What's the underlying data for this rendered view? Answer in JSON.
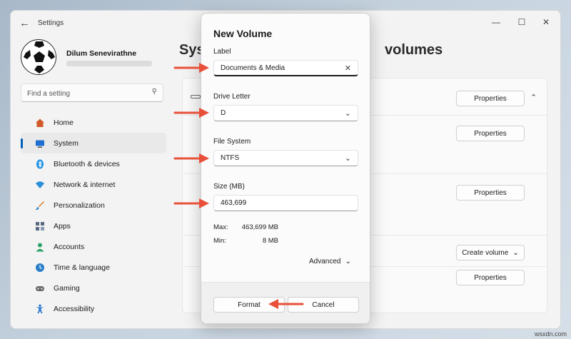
{
  "window": {
    "title": "Settings"
  },
  "profile": {
    "name": "Dilum Senevirathne"
  },
  "search": {
    "placeholder": "Find a setting"
  },
  "nav": {
    "items": [
      {
        "label": "Home",
        "icon": "home-icon",
        "color": "#d05a2a"
      },
      {
        "label": "System",
        "icon": "monitor-icon",
        "color": "#1f6fd0"
      },
      {
        "label": "Bluetooth & devices",
        "icon": "bluetooth-icon",
        "color": "#1a8fe3"
      },
      {
        "label": "Network & internet",
        "icon": "wifi-icon",
        "color": "#2a8fd8"
      },
      {
        "label": "Personalization",
        "icon": "brush-icon",
        "color": "#d47a2a"
      },
      {
        "label": "Apps",
        "icon": "apps-icon",
        "color": "#5a6a82"
      },
      {
        "label": "Accounts",
        "icon": "person-icon",
        "color": "#2fa36b"
      },
      {
        "label": "Time & language",
        "icon": "globe-clock-icon",
        "color": "#2a7fc8"
      },
      {
        "label": "Gaming",
        "icon": "gamepad-icon",
        "color": "#6a6a6a"
      },
      {
        "label": "Accessibility",
        "icon": "accessibility-icon",
        "color": "#1a6fd0"
      }
    ]
  },
  "page": {
    "title_left": "Sys",
    "title_right": "volumes"
  },
  "content": {
    "properties_label": "Properties",
    "create_volume_label": "Create volume"
  },
  "dialog": {
    "title": "New Volume",
    "label_field": {
      "label": "Label",
      "value": "Documents & Media"
    },
    "drive_letter": {
      "label": "Drive Letter",
      "value": "D"
    },
    "file_system": {
      "label": "File System",
      "value": "NTFS"
    },
    "size": {
      "label": "Size (MB)",
      "value": "463,699"
    },
    "max": {
      "label": "Max:",
      "value": "463,699 MB"
    },
    "min": {
      "label": "Min:",
      "value": "8 MB"
    },
    "advanced_label": "Advanced",
    "format_label": "Format",
    "cancel_label": "Cancel"
  },
  "colors": {
    "accent": "#005fb8",
    "annotation_arrow": "#e8503a"
  },
  "watermark": "wsxdn.com"
}
